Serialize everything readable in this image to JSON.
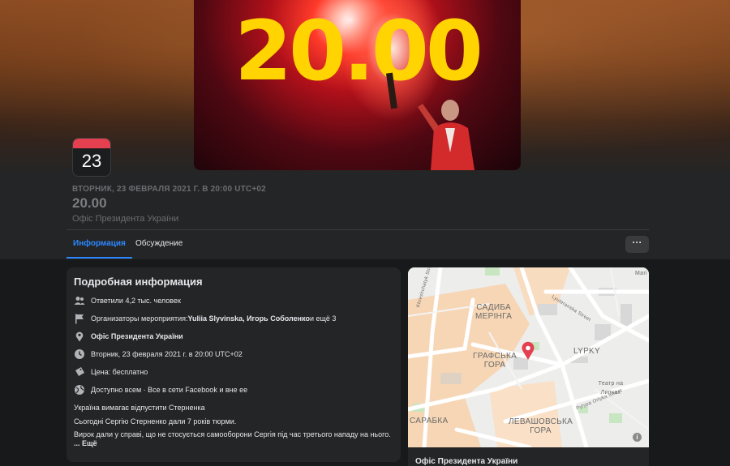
{
  "cover": {
    "headline": "20.00"
  },
  "calendar": {
    "day": "23"
  },
  "event": {
    "date_line": "ВТОРНИК, 23 ФЕВРАЛЯ 2021 Г. В 20:00 UTC+02",
    "title": "20.00",
    "host": "Офіс Президента України"
  },
  "tabs": [
    {
      "label": "Информация",
      "active": true
    },
    {
      "label": "Обсуждение",
      "active": false
    }
  ],
  "more_button": {
    "label": "···"
  },
  "details": {
    "title": "Подробная информация",
    "responded": "Ответили 4,2 тыс. человек",
    "organizers_prefix": "Организаторы мероприятия: ",
    "organizers_names": "Yuliia Slyvinska, Игорь Соболенко",
    "organizers_suffix": " и ещё 3",
    "location": "Офіс Президента України",
    "datetime": "Вторник, 23 февраля 2021 г. в 20:00 UTC+02",
    "price": "Цена: бесплатно",
    "visibility": "Доступно всем · Все в сети Facebook и вне ее",
    "description": [
      "Україна вимагає відпустити Стерненка",
      "Сьогодні Сергію Стерненко дали 7 років тюрми.",
      "Вирок дали у справі, що не стосується самооборони Сергія під час третього нападу на нього."
    ],
    "more_link": "... Ещё"
  },
  "map": {
    "labels": {
      "sadyba_1": "САДИБА",
      "sadyba_2": "МЕРІНГА",
      "grafska_1": "ГРАФСЬКА",
      "grafska_2": "ГОРА",
      "lypky": "LYPKY",
      "saraba": "САРАБКА",
      "levash_1": "ЛЕВАШОВСЬКА",
      "levash_2": "ГОРА",
      "teatr": "Театр на Липках",
      "khreschatyk": "Khreshchatyk Street",
      "lyuteranska": "Lyuteranska Street",
      "orlyka": "Pylypa Orlyka Street",
      "mari": "Mari"
    },
    "footer": "Офіс Президента України",
    "colors": {
      "pin": "#e4404f",
      "block": "#f6d6b5",
      "park": "#c7e6c1",
      "water": "#aad3df"
    }
  }
}
